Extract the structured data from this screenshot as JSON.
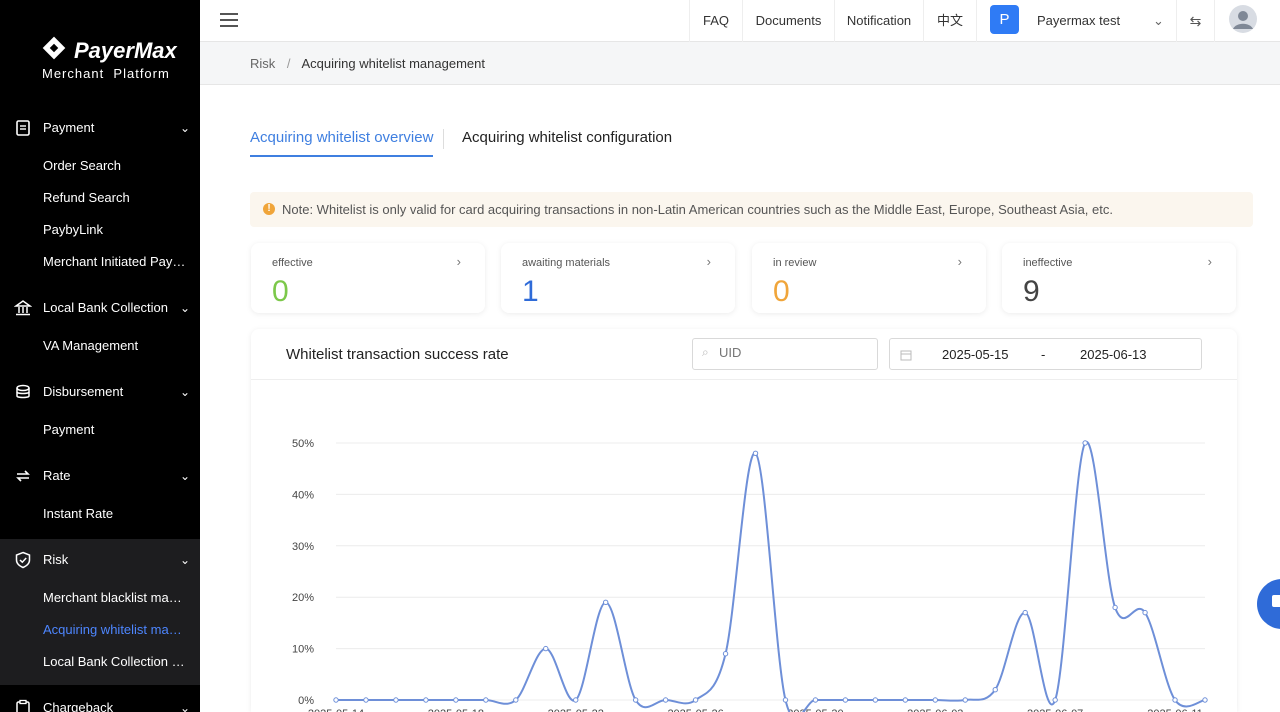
{
  "brand": {
    "name": "PayerMax",
    "sub": "Merchant  Platform"
  },
  "nav": {
    "payment": {
      "label": "Payment",
      "items": [
        "Order Search",
        "Refund Search",
        "PaybyLink",
        "Merchant Initiated Payment"
      ]
    },
    "lbc": {
      "label": "Local Bank Collection",
      "items": [
        "VA Management"
      ]
    },
    "disb": {
      "label": "Disbursement",
      "items": [
        "Payment"
      ]
    },
    "rate": {
      "label": "Rate",
      "items": [
        "Instant Rate"
      ]
    },
    "risk": {
      "label": "Risk",
      "items": [
        "Merchant blacklist management",
        "Acquiring whitelist management",
        "Local Bank Collection List"
      ]
    },
    "charge": {
      "label": "Chargeback"
    }
  },
  "topbar": {
    "faq": "FAQ",
    "docs": "Documents",
    "notif": "Notification",
    "lang": "中文",
    "avatar_letter": "P",
    "account": "Payermax test"
  },
  "breadcrumb": {
    "root": "Risk",
    "sep": "/",
    "current": "Acquiring whitelist management"
  },
  "tabs": {
    "overview": "Acquiring whitelist overview",
    "config": "Acquiring whitelist configuration"
  },
  "note": "Note: Whitelist is only valid for card acquiring transactions in non-Latin American countries such as the Middle East, Europe, Southeast Asia, etc.",
  "cards": [
    {
      "label": "effective",
      "value": "0",
      "color": "#7cc84a"
    },
    {
      "label": "awaiting materials",
      "value": "1",
      "color": "#2f6bd8"
    },
    {
      "label": "in review",
      "value": "0",
      "color": "#f0a53a"
    },
    {
      "label": "ineffective",
      "value": "9",
      "color": "#444444"
    }
  ],
  "panel": {
    "title": "Whitelist transaction success rate",
    "uid_placeholder": "UID",
    "date_start": "2025-05-15",
    "date_sep": "-",
    "date_end": "2025-06-13"
  },
  "chart_data": {
    "type": "line",
    "title": "",
    "ylim": [
      0,
      50
    ],
    "y_ticks": [
      "0%",
      "10%",
      "20%",
      "30%",
      "40%",
      "50%"
    ],
    "x_ticks": [
      "2025-05-14",
      "2025-05-18",
      "2025-05-22",
      "2025-05-26",
      "2025-05-30",
      "2025-06-03",
      "2025-06-07",
      "2025-06-11"
    ],
    "x": [
      "2025-05-14",
      "2025-05-15",
      "2025-05-16",
      "2025-05-17",
      "2025-05-18",
      "2025-05-19",
      "2025-05-20",
      "2025-05-21",
      "2025-05-22",
      "2025-05-23",
      "2025-05-24",
      "2025-05-25",
      "2025-05-26",
      "2025-05-27",
      "2025-05-28",
      "2025-05-29",
      "2025-05-30",
      "2025-05-31",
      "2025-06-01",
      "2025-06-02",
      "2025-06-03",
      "2025-06-04",
      "2025-06-05",
      "2025-06-06",
      "2025-06-07",
      "2025-06-08",
      "2025-06-09",
      "2025-06-10",
      "2025-06-11",
      "2025-06-12"
    ],
    "series": [
      {
        "values": [
          0,
          0,
          0,
          0,
          0,
          0,
          0,
          10,
          0,
          19,
          0,
          0,
          0,
          9,
          48,
          0,
          0,
          0,
          0,
          0,
          0,
          0,
          2,
          17,
          0,
          50,
          18,
          17,
          0,
          0,
          0
        ],
        "color": "#6e8fd8"
      }
    ],
    "grid": true
  },
  "help_color": "#2f6bd8"
}
